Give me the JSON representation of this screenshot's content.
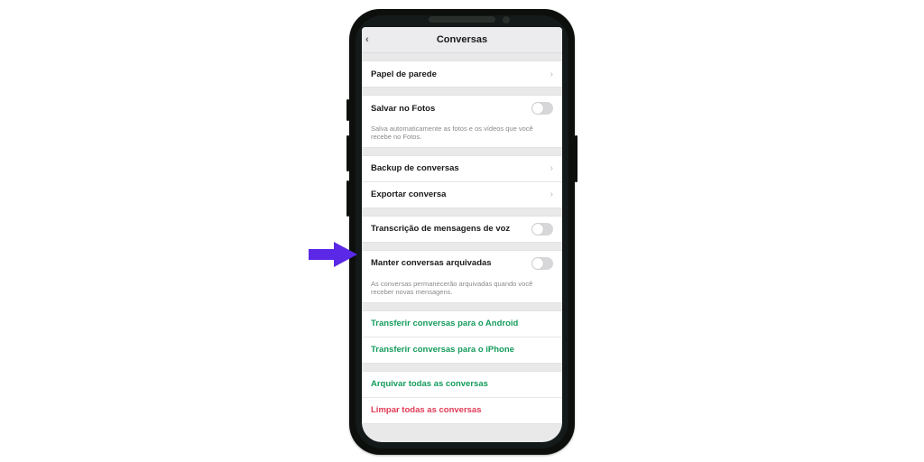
{
  "header": {
    "title": "Conversas"
  },
  "wallpaper": {
    "label": "Papel de parede"
  },
  "savePhotos": {
    "label": "Salvar no Fotos",
    "desc": "Salva automaticamente as fotos e os vídeos que você recebe no Fotos."
  },
  "backup": {
    "label": "Backup de conversas"
  },
  "export": {
    "label": "Exportar conversa"
  },
  "voice": {
    "label": "Transcrição de mensagens de voz"
  },
  "archive": {
    "label": "Manter conversas arquivadas",
    "desc": "As conversas permanecerão arquivadas quando você receber novas mensagens."
  },
  "transferAndroid": {
    "label": "Transferir conversas para o Android"
  },
  "transferIphone": {
    "label": "Transferir conversas para o iPhone"
  },
  "archiveAll": {
    "label": "Arquivar todas as conversas"
  },
  "clearAll": {
    "label": "Limpar todas as conversas"
  }
}
